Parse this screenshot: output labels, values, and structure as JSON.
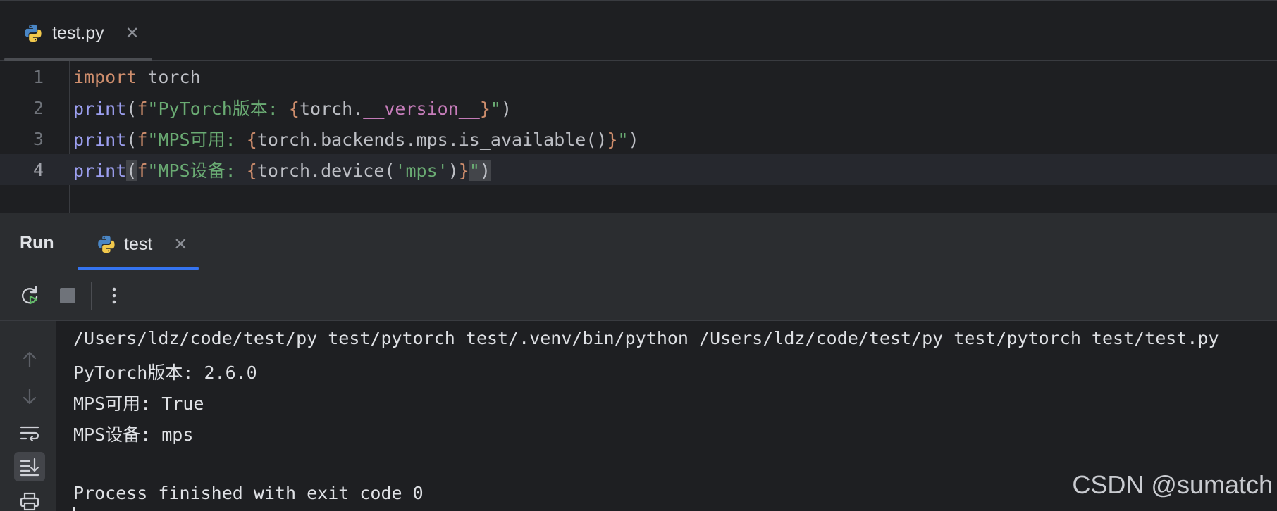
{
  "editor_tab": {
    "filename": "test.py",
    "close_glyph": "✕"
  },
  "code": [
    {
      "line": "1"
    },
    {
      "line": "2"
    },
    {
      "line": "3"
    },
    {
      "line": "4"
    }
  ],
  "code_tokens": {
    "l1": {
      "import": "import",
      "rest": " torch"
    },
    "l2": {
      "print": "print",
      "open": "(",
      "f": "f",
      "q1": "\"PyTorch版本: ",
      "b1": "{",
      "torch": "torch.",
      "dunder": "__version__",
      "b2": "}",
      "q2": "\"",
      "close": ")"
    },
    "l3": {
      "print": "print",
      "open": "(",
      "f": "f",
      "q1": "\"MPS可用: ",
      "b1": "{",
      "expr": "torch.backends.mps.is_available()",
      "b2": "}",
      "q2": "\"",
      "close": ")"
    },
    "l4": {
      "print": "print",
      "open": "(",
      "f": "f",
      "q1": "\"MPS设备: ",
      "b1": "{",
      "expr1": "torch.device(",
      "arg": "'mps'",
      "expr2": ")",
      "b2": "}",
      "q2": "\"",
      "close": ")"
    }
  },
  "run_panel": {
    "title": "Run",
    "tab_label": "test",
    "close_glyph": "✕"
  },
  "console": {
    "lines": [
      "/Users/ldz/code/test/py_test/pytorch_test/.venv/bin/python /Users/ldz/code/test/py_test/pytorch_test/test.py",
      "PyTorch版本: 2.6.0",
      "MPS可用: True",
      "MPS设备: mps",
      "",
      "Process finished with exit code 0"
    ]
  },
  "watermark": "CSDN @sumatch",
  "colors": {
    "accent": "#3574f0",
    "keyword": "#cf8e6d",
    "string": "#6aab73",
    "function": "#9c9ff0",
    "dunder": "#c77dbb"
  }
}
